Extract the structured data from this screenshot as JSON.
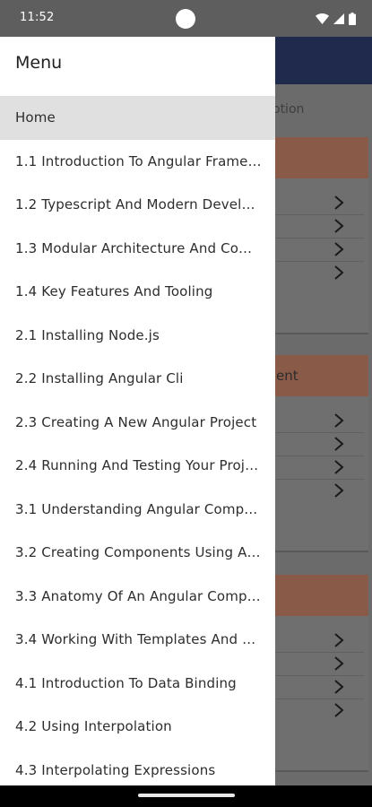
{
  "status_bar": {
    "time": "11:52",
    "icons": [
      "wifi-icon",
      "cellular-signal-icon",
      "battery-icon"
    ]
  },
  "background_app": {
    "tab_fragment": "otion",
    "sections": [
      {
        "title_fragment": ""
      },
      {
        "title_fragment": "ent"
      },
      {
        "title_fragment": ""
      }
    ]
  },
  "drawer": {
    "title": "Menu",
    "selected_index": 0,
    "items": [
      {
        "label": "Home"
      },
      {
        "label": "1.1 Introduction To Angular Frame…"
      },
      {
        "label": "1.2 Typescript And Modern Develo…"
      },
      {
        "label": "1.3 Modular Architecture And Com…"
      },
      {
        "label": "1.4 Key Features And Tooling"
      },
      {
        "label": "2.1 Installing Node.js"
      },
      {
        "label": "2.2 Installing Angular Cli"
      },
      {
        "label": "2.3 Creating A New Angular Project"
      },
      {
        "label": "2.4 Running And Testing Your Proj…"
      },
      {
        "label": "3.1 Understanding Angular Compo…"
      },
      {
        "label": "3.2 Creating Components Using A…"
      },
      {
        "label": "3.3 Anatomy Of An Angular Comp…"
      },
      {
        "label": "3.4 Working With Templates And D…"
      },
      {
        "label": "4.1 Introduction To Data Binding"
      },
      {
        "label": "4.2 Using Interpolation"
      },
      {
        "label": "4.3 Interpolating Expressions"
      }
    ]
  },
  "colors": {
    "app_bar": "#1f2a4d",
    "section_header": "#8a5a48",
    "drawer_selected": "#e0e0e0"
  }
}
